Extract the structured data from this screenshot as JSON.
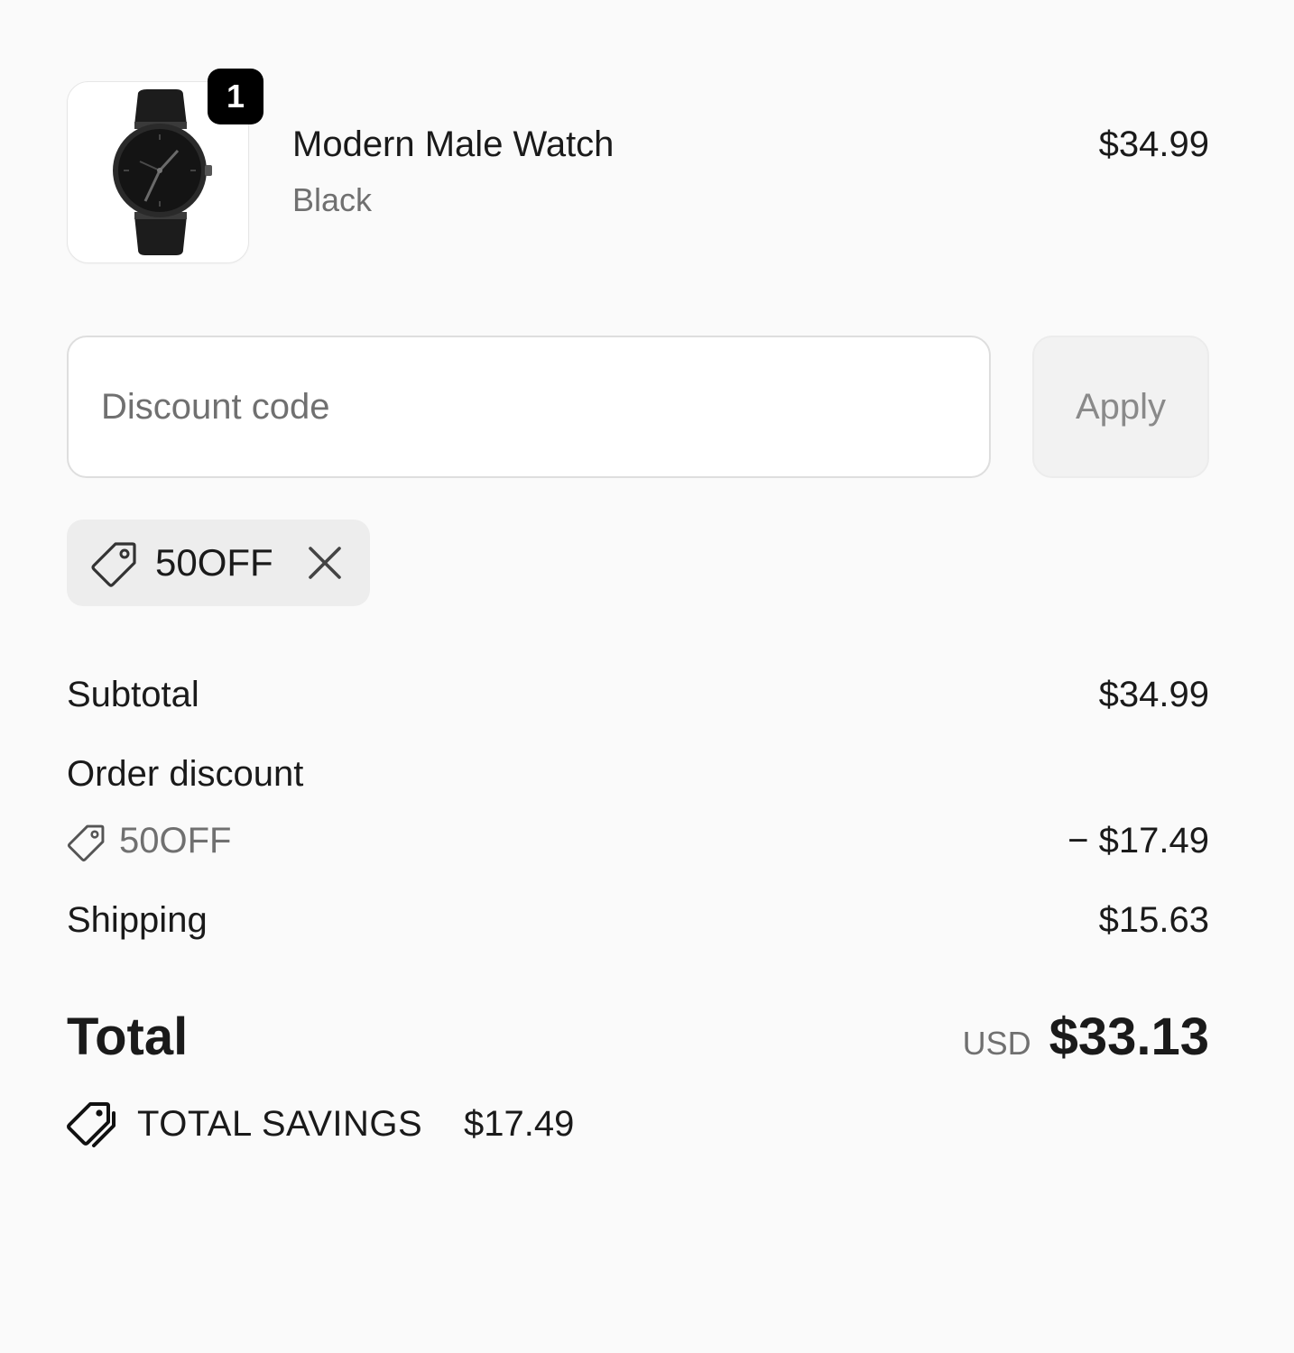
{
  "line_item": {
    "quantity": "1",
    "name": "Modern Male Watch",
    "variant": "Black",
    "price": "$34.99",
    "image_icon": "watch-product-image"
  },
  "discount": {
    "placeholder": "Discount code",
    "value": "",
    "apply_label": "Apply"
  },
  "applied_code": {
    "code": "50OFF",
    "icon": "tag-icon",
    "remove_icon": "close-icon"
  },
  "totals": {
    "subtotal_label": "Subtotal",
    "subtotal_value": "$34.99",
    "order_discount_label": "Order discount",
    "order_discount_code": "50OFF",
    "order_discount_value": "− $17.49",
    "shipping_label": "Shipping",
    "shipping_value": "$15.63",
    "total_label": "Total",
    "total_currency": "USD",
    "total_value": "$33.13"
  },
  "savings": {
    "label": "TOTAL SAVINGS",
    "amount": "$17.49",
    "icon": "double-tag-icon"
  },
  "colors": {
    "background": "#fafafa",
    "text": "#1a1a1a",
    "muted": "#707070",
    "badge": "#000000"
  }
}
